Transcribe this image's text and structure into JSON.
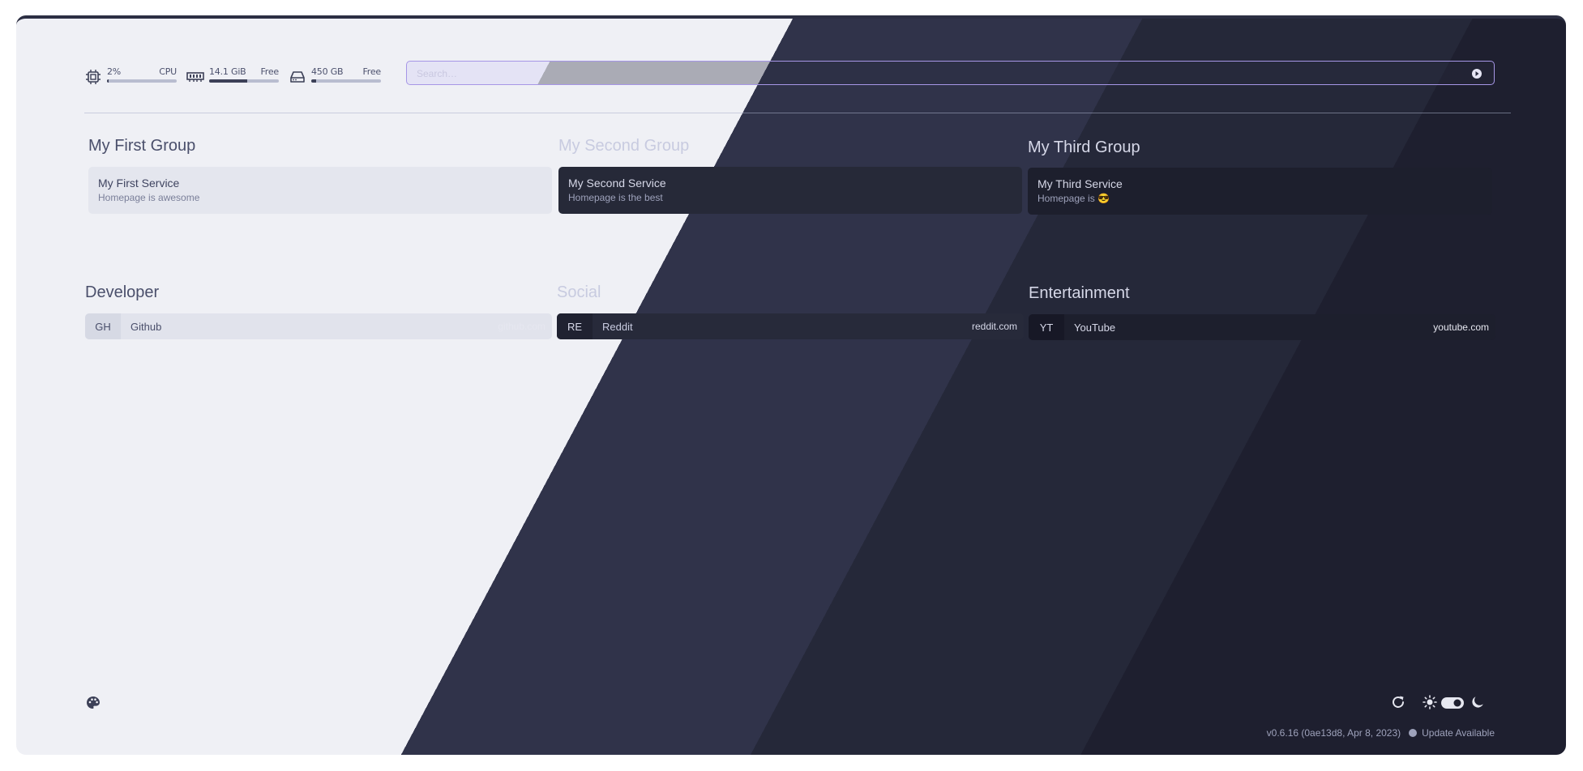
{
  "widgets": {
    "cpu": {
      "value": "2%",
      "label": "CPU",
      "usage_fraction": 0.02,
      "icon": "cpu-icon"
    },
    "memory": {
      "value": "14.1 GiB",
      "label": "Free",
      "usage_fraction": 0.55,
      "icon": "memory-icon"
    },
    "disk": {
      "value": "450 GB",
      "label": "Free",
      "usage_fraction": 0.07,
      "icon": "disk-icon"
    }
  },
  "search": {
    "placeholder": "Search…",
    "provider_icon": "search-provider-icon"
  },
  "groups": [
    {
      "title": "My First Group",
      "services": [
        {
          "name": "My First Service",
          "description": "Homepage is awesome"
        }
      ]
    },
    {
      "title": "My Second Group",
      "services": [
        {
          "name": "My Second Service",
          "description": "Homepage is the best"
        }
      ]
    },
    {
      "title": "My Third Group",
      "services": [
        {
          "name": "My Third Service",
          "description": "Homepage is 😎"
        }
      ]
    }
  ],
  "bookmark_groups": [
    {
      "title": "Developer",
      "bookmarks": [
        {
          "abbr": "GH",
          "name": "Github",
          "href": "github.com"
        }
      ]
    },
    {
      "title": "Social",
      "bookmarks": [
        {
          "abbr": "RE",
          "name": "Reddit",
          "href": "reddit.com"
        }
      ]
    },
    {
      "title": "Entertainment",
      "bookmarks": [
        {
          "abbr": "YT",
          "name": "YouTube",
          "href": "youtube.com"
        }
      ]
    }
  ],
  "footer": {
    "version": "v0.6.16 (0ae13d8, Apr 8, 2023)",
    "update": "Update Available",
    "icons": [
      "palette-icon",
      "refresh-icon",
      "sun-icon",
      "theme-toggle",
      "moon-icon"
    ]
  },
  "colors": {
    "light_bg": "#eff0f5",
    "dark_bg_1": "#30334a",
    "dark_bg_2": "#252839",
    "dark_bg_3": "#1e1f2f",
    "accent": "#a696e6"
  }
}
